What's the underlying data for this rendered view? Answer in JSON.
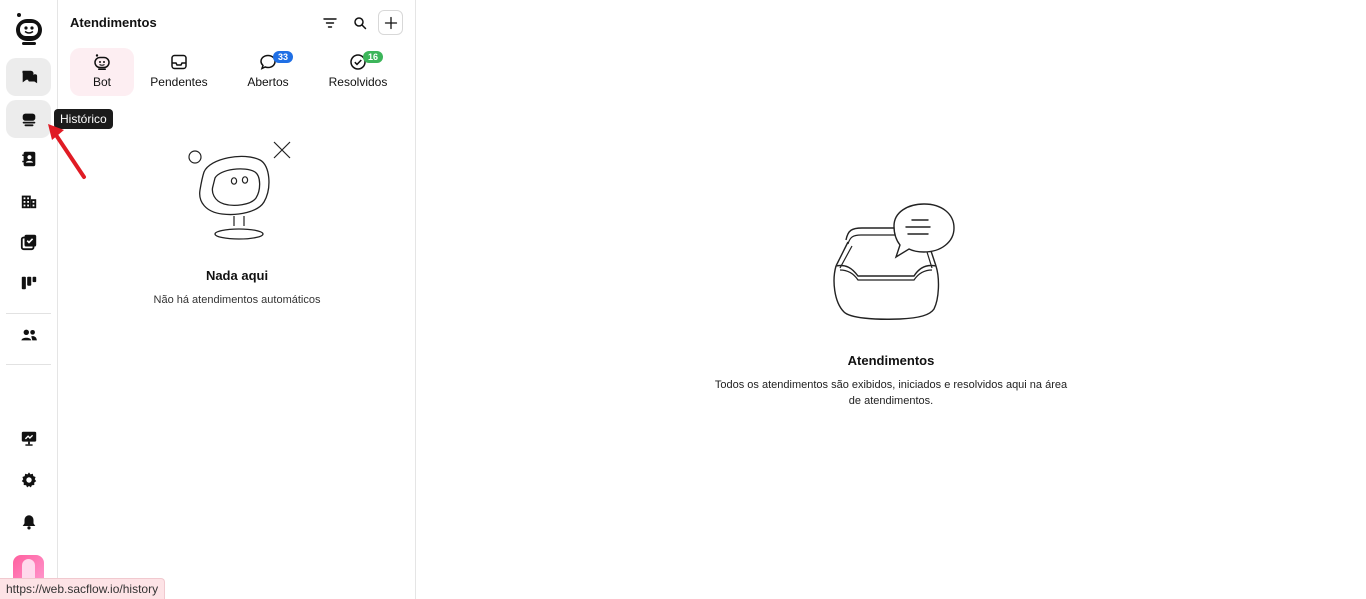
{
  "rail": {
    "tooltip": "Histórico",
    "items": [
      {
        "id": "chats",
        "icon": "chat-bubbles-icon"
      },
      {
        "id": "history",
        "icon": "history-icon"
      },
      {
        "id": "contacts",
        "icon": "contacts-book-icon"
      },
      {
        "id": "companies",
        "icon": "building-icon"
      },
      {
        "id": "tasks",
        "icon": "tasks-check-icon"
      },
      {
        "id": "kanban",
        "icon": "kanban-icon"
      },
      {
        "id": "team",
        "icon": "team-icon"
      },
      {
        "id": "presentation",
        "icon": "presentation-icon"
      },
      {
        "id": "settings",
        "icon": "gear-icon"
      },
      {
        "id": "notifications",
        "icon": "bell-icon"
      }
    ]
  },
  "panel": {
    "title": "Atendimentos",
    "tabs": [
      {
        "label": "Bot",
        "icon": "bot-icon",
        "active": true
      },
      {
        "label": "Pendentes",
        "icon": "inbox-icon"
      },
      {
        "label": "Abertos",
        "icon": "chat-icon",
        "badge": "33",
        "badge_color": "#1f6fe5"
      },
      {
        "label": "Resolvidos",
        "icon": "check-circle-icon",
        "badge": "16",
        "badge_color": "#3cb55a"
      }
    ],
    "empty": {
      "title": "Nada aqui",
      "subtitle": "Não há atendimentos automáticos"
    }
  },
  "main": {
    "empty": {
      "title": "Atendimentos",
      "subtitle": "Todos os atendimentos são exibidos, iniciados e resolvidos aqui na área de atendimentos."
    }
  },
  "status_bar": {
    "url": "https://web.sacflow.io/history"
  },
  "colors": {
    "active_tab_bg": "#fdeef2",
    "badge_blue": "#1f6fe5",
    "badge_green": "#3cb55a",
    "arrow": "#e01b24"
  }
}
